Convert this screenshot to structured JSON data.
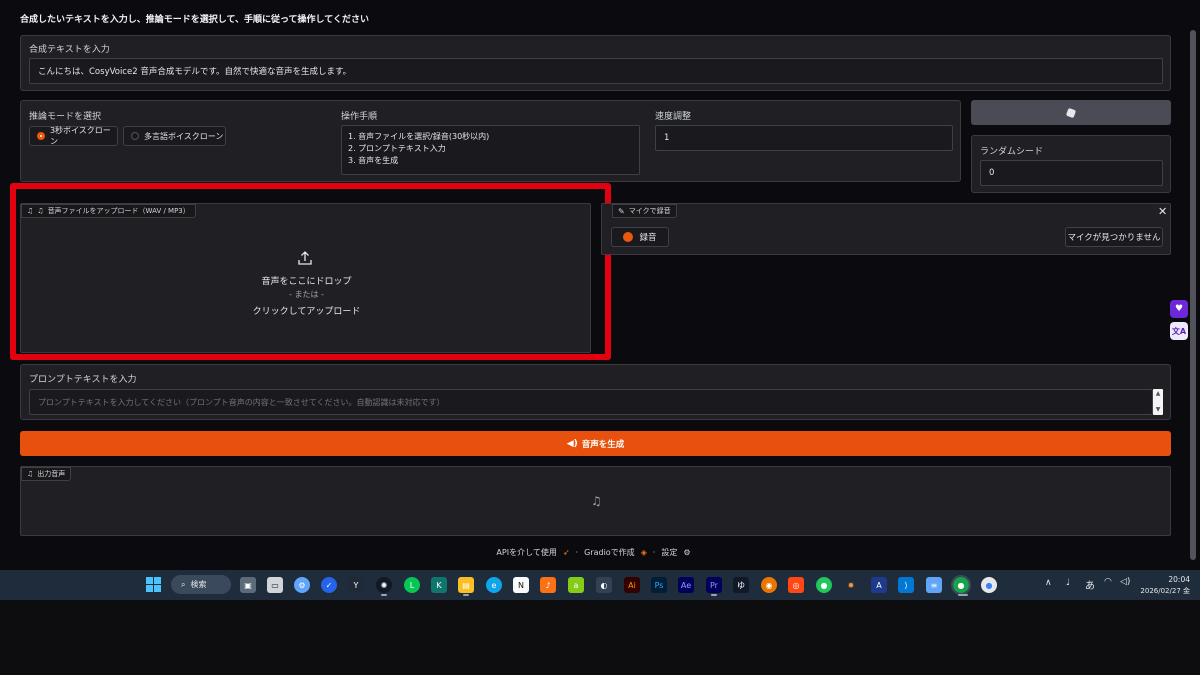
{
  "page": {
    "instructions": "合成したいテキストを入力し、推論モードを選択して、手順に従って操作してください"
  },
  "text_input": {
    "label": "合成テキストを入力",
    "value": "こんにちは、CosyVoice2 音声合成モデルです。自然で快適な音声を生成します。"
  },
  "mode": {
    "label": "推論モードを選択",
    "options": [
      "3秒ボイスクローン",
      "多言語ボイスクローン"
    ],
    "selected": "3秒ボイスクローン"
  },
  "steps": {
    "label": "操作手順",
    "lines": [
      "1. 音声ファイルを選択/録音(30秒以内)",
      "2. プロンプトテキスト入力",
      "3. 音声を生成"
    ]
  },
  "speed": {
    "label": "速度調整",
    "value": "1"
  },
  "seed": {
    "dice_icon": "dice-icon",
    "label": "ランダムシード",
    "value": "0"
  },
  "upload": {
    "tab_label": "音声ファイルをアップロード（WAV / MP3）",
    "drop_text": "音声をここにドロップ",
    "or_text": "- または -",
    "click_text": "クリックしてアップロード"
  },
  "record": {
    "tab_label": "マイクで録音",
    "record_button": "録音",
    "mic_status": "マイクが見つかりません"
  },
  "prompt": {
    "label": "プロンプトテキストを入力",
    "placeholder": "プロンプトテキストを入力してください（プロンプト音声の内容と一致させてください。自動認識は未対応です）"
  },
  "generate": {
    "label": "音声を生成"
  },
  "output": {
    "tab_label": "出力音声"
  },
  "footer": {
    "api": "APIを介して使用",
    "gradio": "Gradioで作成",
    "settings": "設定",
    "sep": "·"
  },
  "taskbar": {
    "search": "検索",
    "ime": "あ",
    "time": "20:04",
    "date": "2026/02/27 金"
  },
  "colors": {
    "accent": "#ea580c",
    "highlight": "#e3010f",
    "panel": "#202024",
    "taskbar": "#1f2c3b"
  }
}
